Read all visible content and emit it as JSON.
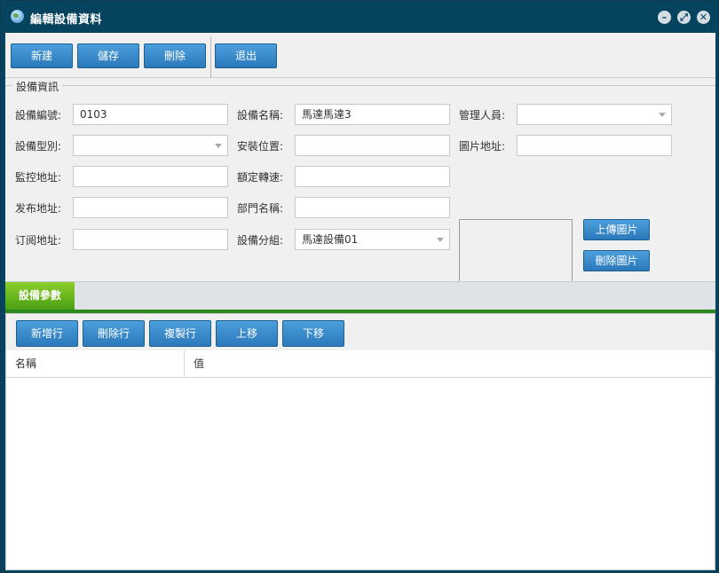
{
  "window": {
    "title": "編輯設備資料",
    "controls": [
      "minimize-icon",
      "restore-icon",
      "close-icon"
    ]
  },
  "toolbar": {
    "new_label": "新建",
    "save_label": "儲存",
    "delete_label": "刪除",
    "exit_label": "退出"
  },
  "section": {
    "legend": "設備資訊"
  },
  "form": {
    "device_no": {
      "label": "設備編號:",
      "value": "0103"
    },
    "device_name": {
      "label": "設備名稱:",
      "value": "馬達馬達3"
    },
    "manager": {
      "label": "管理人員:",
      "value": ""
    },
    "device_type": {
      "label": "設備型別:",
      "value": ""
    },
    "install_location": {
      "label": "安裝位置:",
      "value": ""
    },
    "image_url": {
      "label": "圖片地址:",
      "value": ""
    },
    "monitor_url": {
      "label": "監控地址:",
      "value": ""
    },
    "rated_speed": {
      "label": "額定轉速:",
      "value": ""
    },
    "publish_url": {
      "label": "发布地址:",
      "value": ""
    },
    "dept_name": {
      "label": "部門名稱:",
      "value": ""
    },
    "subscribe_url": {
      "label": "订阅地址:",
      "value": ""
    },
    "device_group": {
      "label": "設備分組:",
      "value": "馬達設備01"
    }
  },
  "image_buttons": {
    "upload_label": "上傳圖片",
    "delete_label": "刪除圖片"
  },
  "tabs": [
    {
      "label": "設備參數",
      "active": true
    }
  ],
  "grid_toolbar": {
    "add_row": "新增行",
    "delete_row": "刪除行",
    "copy_row": "複製行",
    "move_up": "上移",
    "move_down": "下移"
  },
  "grid": {
    "columns": [
      "名稱",
      "值"
    ],
    "rows": []
  },
  "colors": {
    "titlebar": "#06435f",
    "button": "#2b78ba",
    "tab_active": "#6bb823",
    "tab_underline": "#2a8a1e"
  }
}
